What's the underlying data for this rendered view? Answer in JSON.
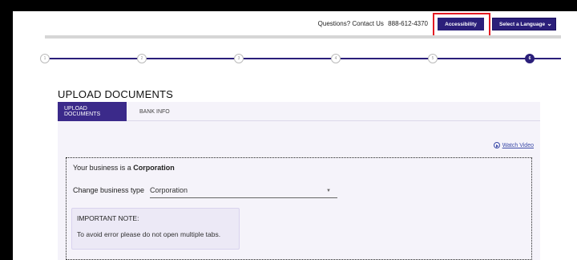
{
  "header": {
    "contact_text": "Questions? Contact Us",
    "phone": "888-612-4370",
    "accessibility_label": "Accessibility",
    "language_label": "Select a Language"
  },
  "stepper": {
    "steps": [
      "1",
      "2",
      "3",
      "4",
      "5",
      "6"
    ],
    "active_step": "6"
  },
  "page": {
    "title": "UPLOAD DOCUMENTS"
  },
  "tabs": [
    {
      "label": "UPLOAD DOCUMENTS",
      "active": true
    },
    {
      "label": "BANK INFO",
      "active": false
    }
  ],
  "watch_video": "Watch Video",
  "business": {
    "prefix": "Your business is a",
    "type": "Corporation",
    "change_label": "Change business type",
    "selected": "Corporation"
  },
  "note": {
    "heading": "IMPORTANT NOTE:",
    "text": "To avoid error please do not open multiple tabs."
  },
  "colors": {
    "brand": "#2b1f7a",
    "highlight": "#e31b23",
    "link": "#3b4aa8"
  }
}
